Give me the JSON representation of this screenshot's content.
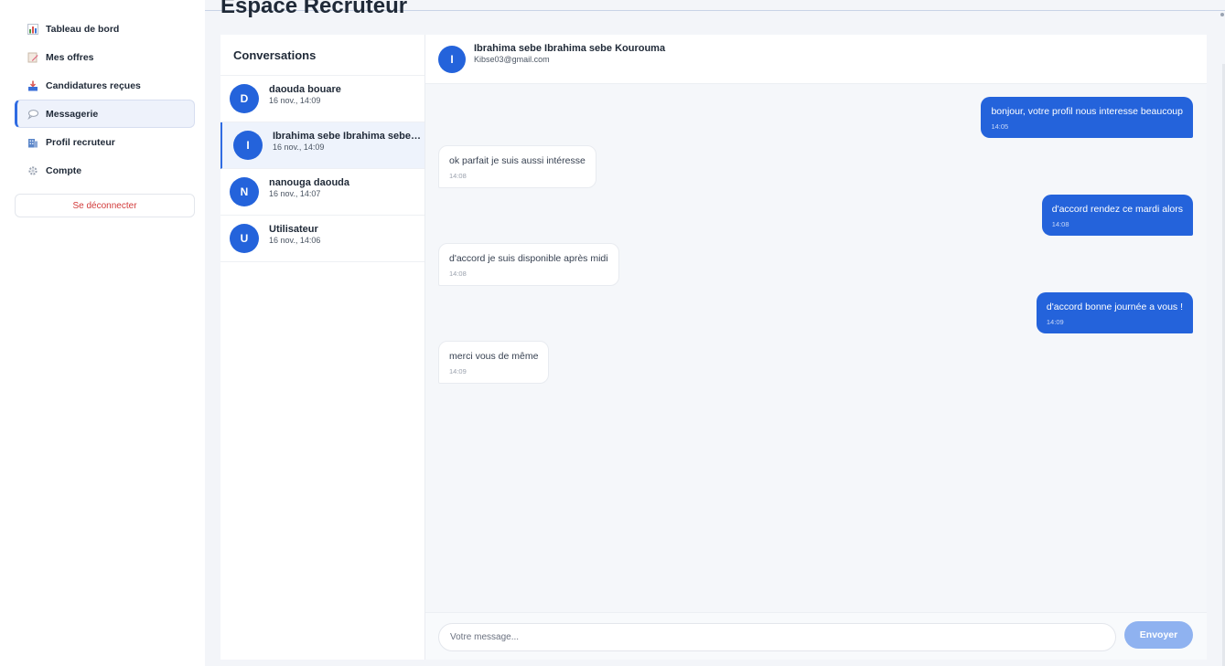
{
  "sidebar": {
    "items": [
      {
        "label": "Tableau de bord",
        "icon": "bar-chart-icon"
      },
      {
        "label": "Mes offres",
        "icon": "memo-icon"
      },
      {
        "label": "Candidatures reçues",
        "icon": "inbox-tray-icon"
      },
      {
        "label": "Messagerie",
        "icon": "speech-bubble-icon",
        "active": true
      },
      {
        "label": "Profil recruteur",
        "icon": "office-building-icon"
      },
      {
        "label": "Compte",
        "icon": "gear-icon"
      }
    ],
    "logout_label": "Se déconnecter"
  },
  "page": {
    "title": "Espace Recruteur"
  },
  "conversations": {
    "title": "Conversations",
    "items": [
      {
        "initial": "D",
        "name": "daouda bouare",
        "time": "16 nov., 14:09"
      },
      {
        "initial": "I",
        "name": "Ibrahima sebe Ibrahima sebe Kourouma",
        "time": "16 nov., 14:09",
        "active": true
      },
      {
        "initial": "N",
        "name": "nanouga daouda",
        "time": "16 nov., 14:07"
      },
      {
        "initial": "U",
        "name": "Utilisateur",
        "time": "16 nov., 14:06"
      }
    ]
  },
  "chat": {
    "initial": "I",
    "name": "Ibrahima sebe Ibrahima sebe Kourouma",
    "email": "Kibse03@gmail.com",
    "messages": [
      {
        "direction": "out",
        "text": "bonjour, votre profil nous interesse beaucoup",
        "time": "14:05"
      },
      {
        "direction": "in",
        "text": "ok parfait je suis aussi intéresse",
        "time": "14:08"
      },
      {
        "direction": "out",
        "text": "d'accord rendez ce mardi alors",
        "time": "14:08"
      },
      {
        "direction": "in",
        "text": "d'accord je suis disponible après midi",
        "time": "14:08"
      },
      {
        "direction": "out",
        "text": "d'accord bonne journée a vous !",
        "time": "14:09"
      },
      {
        "direction": "in",
        "text": "merci vous de même",
        "time": "14:09"
      }
    ],
    "input_placeholder": "Votre message...",
    "input_value": "",
    "send_label": "Envoyer"
  },
  "colors": {
    "accent": "#2463db",
    "logout": "#d23b3b",
    "send_disabled": "#8fb2f0"
  }
}
